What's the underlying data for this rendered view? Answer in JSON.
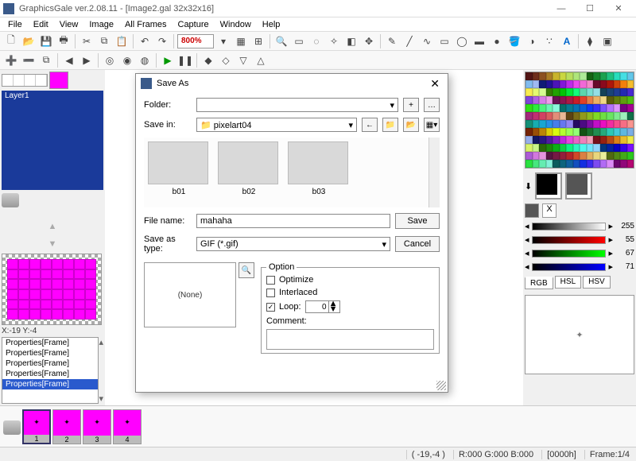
{
  "titlebar": {
    "text": "GraphicsGale ver.2.08.11 - [Image2.gal 32x32x16]"
  },
  "menus": [
    "File",
    "Edit",
    "View",
    "Image",
    "All Frames",
    "Capture",
    "Window",
    "Help"
  ],
  "zoom": "800%",
  "left": {
    "layer_name": "Layer1",
    "coord": "X:-19 Y:-4",
    "props": [
      "Properties[Frame]",
      "Properties[Frame]",
      "Properties[Frame]",
      "Properties[Frame]",
      "Properties[Frame]"
    ]
  },
  "right": {
    "sliders": [
      {
        "val": "255"
      },
      {
        "val": "55"
      },
      {
        "val": "67"
      },
      {
        "val": "71"
      }
    ],
    "tabs": [
      "RGB",
      "HSL",
      "HSV"
    ]
  },
  "frames": [
    "1",
    "2",
    "3",
    "4"
  ],
  "status": {
    "pos": "( -19,-4 )",
    "rgb": "R:000 G:000 B:000",
    "hex": "[0000h]",
    "frame": "Frame:1/4"
  },
  "dialog": {
    "title": "Save As",
    "folder_label": "Folder:",
    "folder_value": "",
    "savein_label": "Save in:",
    "savein_value": "pixelart04",
    "files": [
      "b01",
      "b02",
      "b03"
    ],
    "filename_label": "File name:",
    "filename_value": "mahaha",
    "savetype_label": "Save as type:",
    "savetype_value": "GIF (*.gif)",
    "save_btn": "Save",
    "cancel_btn": "Cancel",
    "none_label": "(None)",
    "option_legend": "Option",
    "optimize": "Optimize",
    "interlaced": "Interlaced",
    "loop_label": "Loop:",
    "loop_value": "0",
    "comment_label": "Comment:"
  }
}
